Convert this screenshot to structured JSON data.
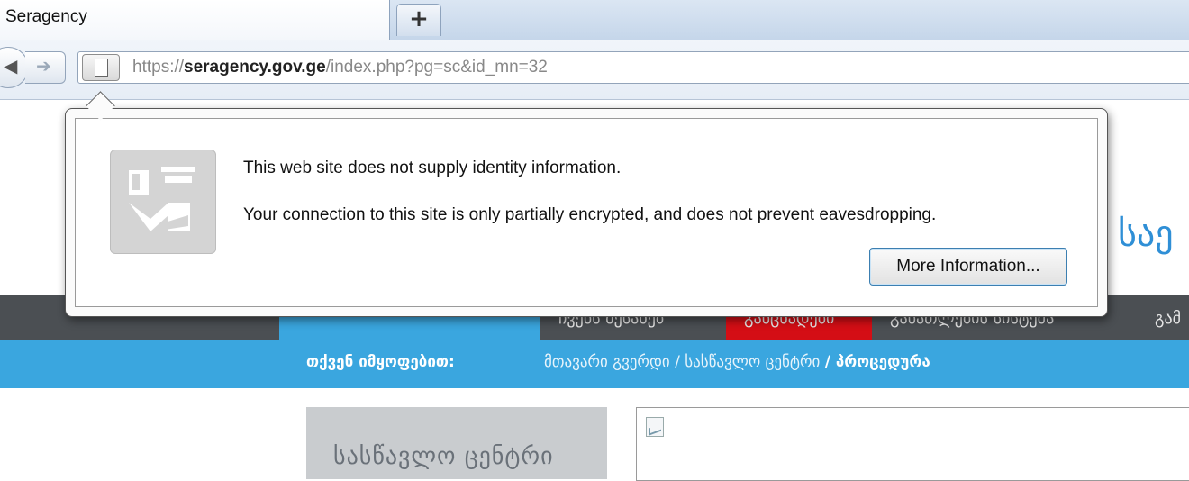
{
  "browser": {
    "tab_title": "Seragency",
    "new_tab_label": "+",
    "url": {
      "scheme": "https://",
      "host": "seragency.gov.ge",
      "path": "/index.php?pg=sc&id_mn=32"
    }
  },
  "identity_popup": {
    "line1": "This web site does not supply identity information.",
    "line2": "Your connection to this site is only partially encrypted, and does not prevent eavesdropping.",
    "more_info_button": "More Information...",
    "icon": "passport-officer-icon"
  },
  "page": {
    "logo_partial": "ა საე",
    "menu": [
      "ჩვენს შესახებ",
      "განცხადები",
      "განათლების სისტემა",
      "გამ"
    ],
    "breadcrumb": {
      "prefix": "თქვენ იმყოფებით:",
      "path": "მთავარი გვერდი / სასწავლო ცენტრი",
      "current": "/ პროცედურა"
    },
    "sidebar_title": "სასწავლო ცენტრი",
    "colors": {
      "blue": "#3aa6df",
      "dark_menu": "#4b4f53",
      "red": "#d40e15"
    }
  }
}
